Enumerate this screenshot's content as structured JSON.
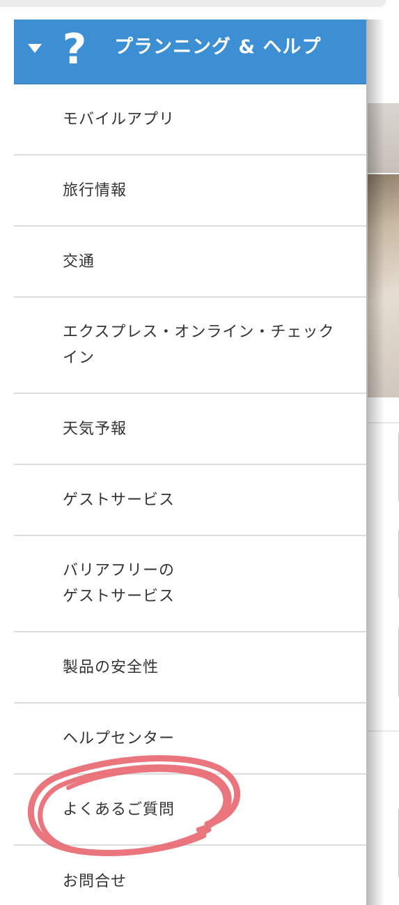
{
  "header": {
    "title": "プランニング & ヘルプ",
    "expand_icon": "caret-down-icon",
    "help_icon": "question-mark-icon",
    "help_icon_glyph": "?",
    "background_color": "#3d8fd4"
  },
  "menu": {
    "items": [
      {
        "label": "モバイルアプリ"
      },
      {
        "label": "旅行情報"
      },
      {
        "label": "交通"
      },
      {
        "label": "エクスプレス・オンライン・チェック\nイン"
      },
      {
        "label": "天気予報"
      },
      {
        "label": "ゲストサービス"
      },
      {
        "label": "バリアフリーの\nゲストサービス"
      },
      {
        "label": "製品の安全性"
      },
      {
        "label": "ヘルプセンター"
      },
      {
        "label": "よくあるご質問"
      },
      {
        "label": "お問合せ"
      }
    ]
  },
  "annotation": {
    "shape": "hand-drawn-circle",
    "color": "#e8636b",
    "target_item": "よくあるご質問"
  }
}
